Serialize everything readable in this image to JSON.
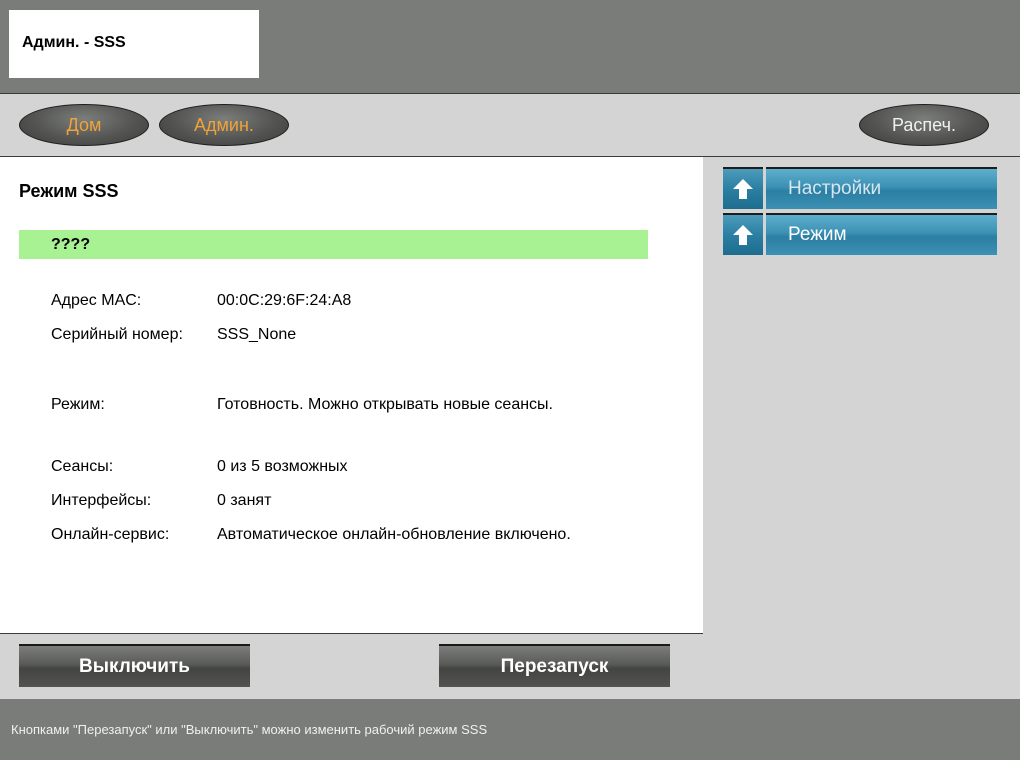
{
  "header": {
    "title": "Админ. - SSS"
  },
  "nav": {
    "home": "Дом",
    "admin": "Админ.",
    "print": "Распеч."
  },
  "main": {
    "title": "Режим SSS",
    "status": "????",
    "fields": [
      {
        "label": "Адрес MAC:",
        "value": "00:0C:29:6F:24:A8"
      },
      {
        "label": "Серийный номер:",
        "value": "SSS_None"
      },
      {
        "label": "Режим:",
        "value": "Готовность. Можно открывать новые сеансы."
      },
      {
        "label": "Сеансы:",
        "value": "0 из 5 возможных"
      },
      {
        "label": "Интерфейсы:",
        "value": "0 занят"
      },
      {
        "label": "Онлайн-сервис:",
        "value": "Автоматическое онлайн-обновление включено."
      }
    ]
  },
  "sidebar": {
    "items": [
      {
        "label": "Настройки",
        "icon": "up-arrow-icon"
      },
      {
        "label": "Режим",
        "icon": "up-arrow-icon"
      }
    ]
  },
  "actions": {
    "shutdown": "Выключить",
    "restart": "Перезапуск"
  },
  "footer": {
    "text": "Кнопками \"Перезапуск\" или \"Выключить\" можно изменить рабочий режим SSS"
  },
  "colors": {
    "accent_orange": "#f0a336",
    "status_green": "#a8f294",
    "sidebar_blue": "#3b90b4"
  }
}
